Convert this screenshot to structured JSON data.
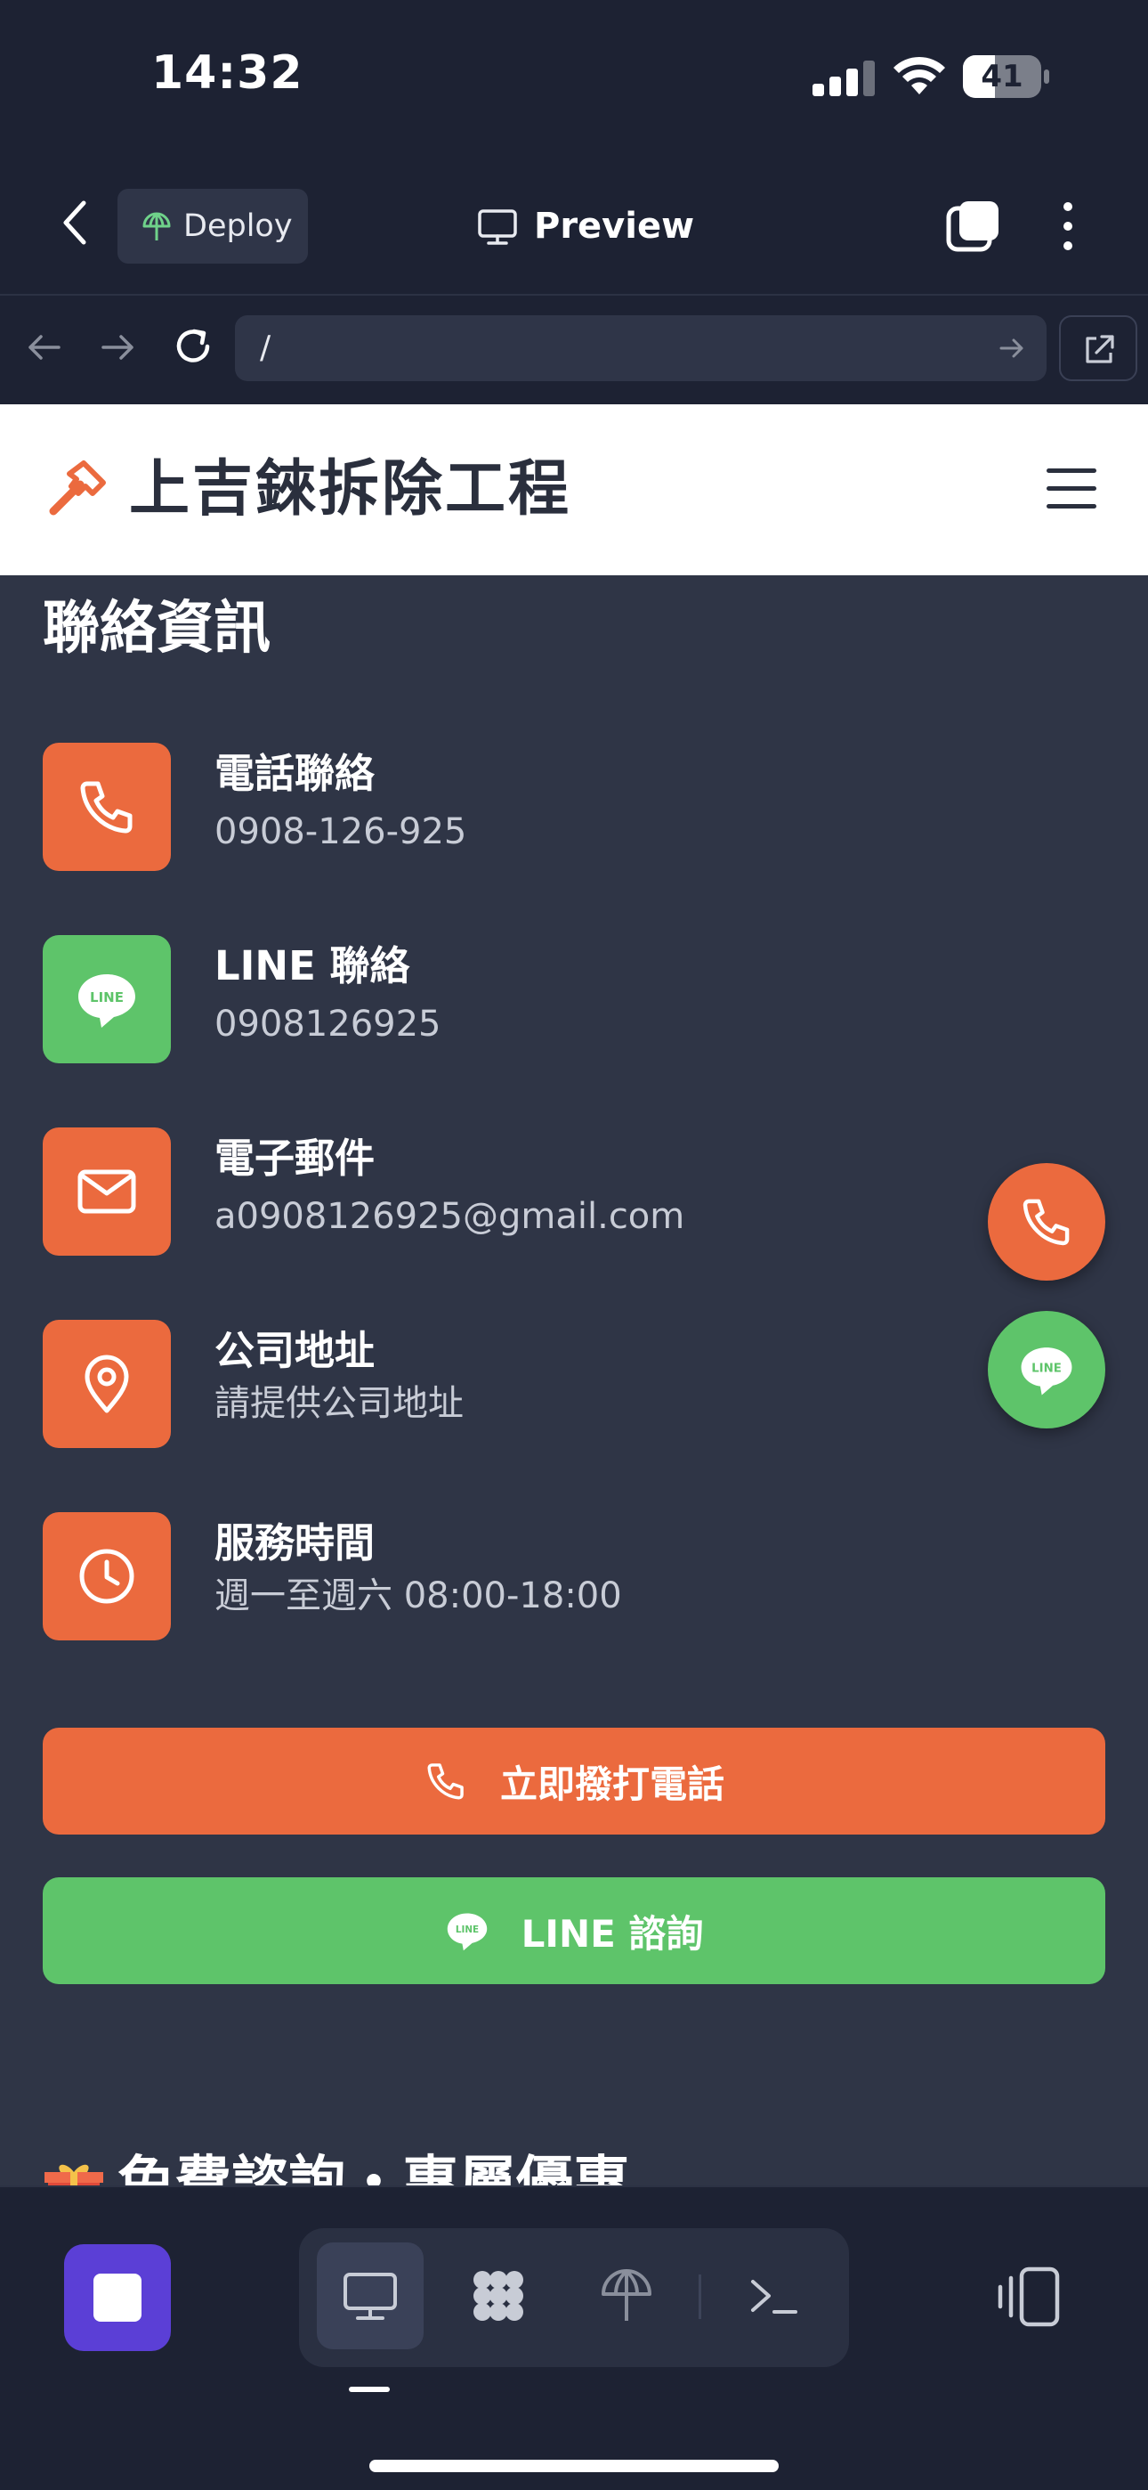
{
  "status_bar": {
    "time": "14:32",
    "battery": "41",
    "battery_level": 0.41
  },
  "app_header": {
    "deploy_label": "Deploy",
    "preview_label": "Preview"
  },
  "url_bar": {
    "url": "/"
  },
  "site": {
    "title": "上吉錸拆除工程",
    "section_title": "聯絡資訊",
    "contacts": [
      {
        "label": "電話聯絡",
        "value": "0908-126-925",
        "icon": "phone-icon"
      },
      {
        "label": "LINE 聯絡",
        "value": "0908126925",
        "icon": "line-icon"
      },
      {
        "label": "電子郵件",
        "value": "a0908126925@gmail.com",
        "icon": "mail-icon"
      },
      {
        "label": "公司地址",
        "value": "請提供公司地址",
        "icon": "map-pin-icon"
      },
      {
        "label": "服務時間",
        "value": "週一至週六 08:00-18:00",
        "icon": "clock-icon"
      }
    ],
    "call_button": "立即撥打電話",
    "line_button": "LINE 諮詢",
    "next_section_title": "免費諮詢・專屬優惠",
    "line_badge": "LINE"
  },
  "colors": {
    "accent_orange": "#eb6a3e",
    "line_green": "#5ec46a",
    "app_bg": "#1d2233",
    "content_bg": "#2f3546",
    "stop_purple": "#5b3fd6"
  }
}
